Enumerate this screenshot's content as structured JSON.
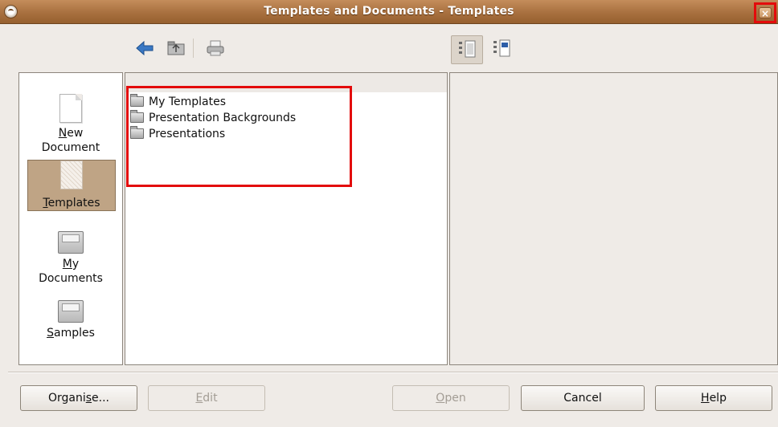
{
  "window": {
    "title": "Templates and Documents - Templates",
    "close_label": "×"
  },
  "toolbar": {
    "icons": [
      "back-icon",
      "folder-up-icon",
      "print-icon",
      "preview-view-icon",
      "document-properties-icon"
    ]
  },
  "sidebar": {
    "items": [
      {
        "label_mnemonic": "N",
        "label_rest": "ew",
        "label_line2": "Document",
        "icon": "new-document-icon"
      },
      {
        "label_mnemonic": "T",
        "label_rest": "emplates",
        "icon": "templates-icon",
        "selected": true
      },
      {
        "label_mnemonic": "M",
        "label_rest": "y",
        "label_line2": "Documents",
        "icon": "my-documents-icon"
      },
      {
        "label_mnemonic": "S",
        "label_rest": "amples",
        "icon": "samples-icon"
      }
    ]
  },
  "files": [
    {
      "name": "My Templates",
      "icon": "folder-icon"
    },
    {
      "name": "Presentation Backgrounds",
      "icon": "folder-icon"
    },
    {
      "name": "Presentations",
      "icon": "folder-icon"
    }
  ],
  "buttons": {
    "organise_pre": "Organi",
    "organise_mn": "s",
    "organise_post": "e...",
    "edit_mn": "E",
    "edit_rest": "dit",
    "open_mn": "O",
    "open_rest": "pen",
    "cancel": "Cancel",
    "help_mn": "H",
    "help_rest": "elp"
  },
  "colors": {
    "titlebar": "#a8703f",
    "highlight": "#e30b0b",
    "selected_sidebar": "#bfa485"
  }
}
